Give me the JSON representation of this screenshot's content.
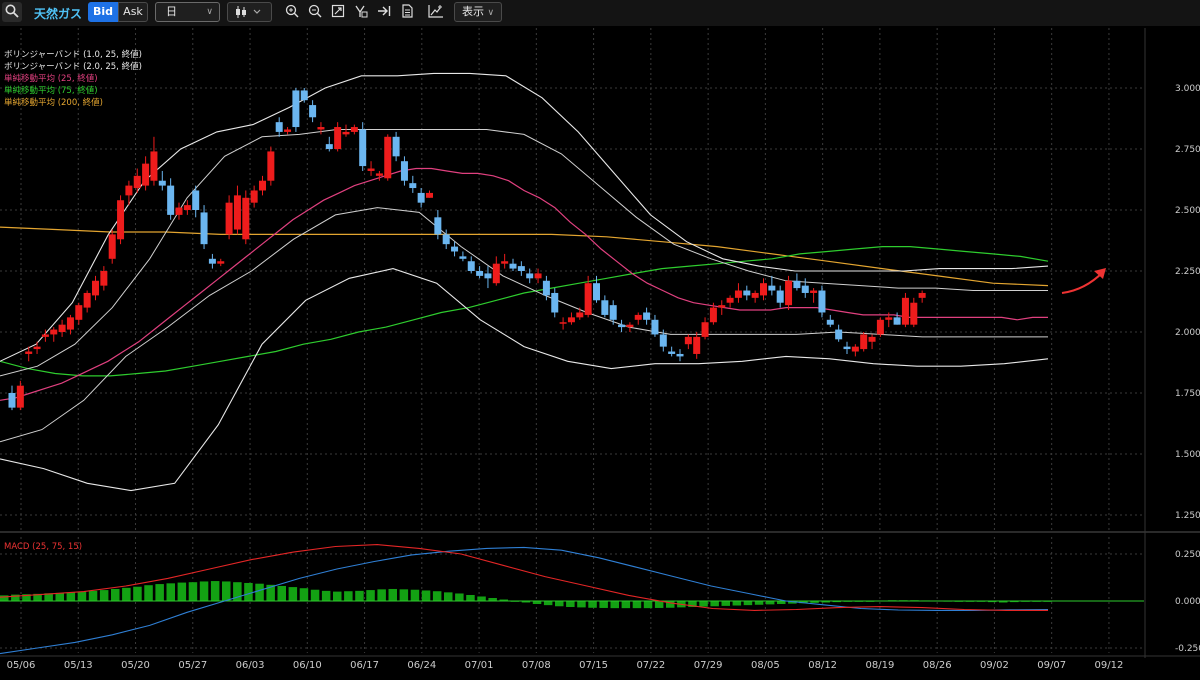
{
  "toolbar": {
    "search_icon": "search-icon",
    "instrument": "天然ガス",
    "bid_label": "Bid",
    "ask_label": "Ask",
    "timeframe": "日",
    "chart_type_icon": "candlestick-icon",
    "tools": [
      "zoom-in-icon",
      "zoom-out-icon",
      "fit-icon",
      "crosshair-icon",
      "go-latest-icon",
      "document-icon",
      "add-indicator-icon"
    ],
    "display_label": "表示",
    "accent": "#1e72e6",
    "instrument_color": "#4fc3f7"
  },
  "chart_data": [
    {
      "type": "candlestick",
      "title": "",
      "legend": [
        {
          "label": "ボリンジャーバンド (1.0, 25, 終値)",
          "color": "#e8e8e8"
        },
        {
          "label": "ボリンジャーバンド (2.0, 25, 終値)",
          "color": "#e8e8e8"
        },
        {
          "label": "単純移動平均 (25, 終値)",
          "color": "#e0407f"
        },
        {
          "label": "単純移動平均 (75, 終値)",
          "color": "#2ecc2e"
        },
        {
          "label": "単純移動平均 (200, 終値)",
          "color": "#e3a530"
        }
      ],
      "ylim": [
        1.175,
        3.05
      ],
      "yticks": [
        "3.000",
        "2.750",
        "2.500",
        "2.250",
        "2.000",
        "1.750",
        "1.500",
        "1.250"
      ],
      "xticks": [
        "05/06",
        "05/13",
        "05/20",
        "05/27",
        "06/03",
        "06/10",
        "06/17",
        "06/24",
        "07/01",
        "07/08",
        "07/15",
        "07/22",
        "07/29",
        "08/05",
        "08/12",
        "08/19",
        "08/26",
        "09/02",
        "09/07",
        "09/12"
      ],
      "up_color": "#ee1c1c",
      "down_color": "#6bb6f0",
      "candles": [
        [
          1.75,
          1.78,
          1.68,
          1.69
        ],
        [
          1.69,
          1.8,
          1.68,
          1.78
        ],
        [
          1.91,
          1.94,
          1.88,
          1.92
        ],
        [
          1.93,
          1.96,
          1.91,
          1.94
        ],
        [
          1.98,
          2.01,
          1.96,
          1.99
        ],
        [
          1.99,
          2.02,
          1.96,
          2.01
        ],
        [
          2.0,
          2.05,
          1.98,
          2.03
        ],
        [
          2.01,
          2.07,
          1.99,
          2.06
        ],
        [
          2.05,
          2.12,
          2.03,
          2.11
        ],
        [
          2.1,
          2.17,
          2.08,
          2.16
        ],
        [
          2.15,
          2.23,
          2.13,
          2.21
        ],
        [
          2.19,
          2.27,
          2.17,
          2.25
        ],
        [
          2.3,
          2.42,
          2.28,
          2.4
        ],
        [
          2.38,
          2.56,
          2.36,
          2.54
        ],
        [
          2.56,
          2.62,
          2.52,
          2.6
        ],
        [
          2.59,
          2.67,
          2.57,
          2.64
        ],
        [
          2.6,
          2.72,
          2.58,
          2.69
        ],
        [
          2.62,
          2.8,
          2.6,
          2.74
        ],
        [
          2.62,
          2.66,
          2.58,
          2.6
        ],
        [
          2.6,
          2.63,
          2.46,
          2.48
        ],
        [
          2.48,
          2.53,
          2.46,
          2.51
        ],
        [
          2.5,
          2.54,
          2.48,
          2.52
        ],
        [
          2.58,
          2.6,
          2.47,
          2.5
        ],
        [
          2.49,
          2.52,
          2.34,
          2.36
        ],
        [
          2.3,
          2.32,
          2.26,
          2.28
        ],
        [
          2.28,
          2.3,
          2.27,
          2.29
        ],
        [
          2.4,
          2.56,
          2.38,
          2.53
        ],
        [
          2.42,
          2.6,
          2.4,
          2.56
        ],
        [
          2.38,
          2.58,
          2.36,
          2.55
        ],
        [
          2.53,
          2.6,
          2.51,
          2.58
        ],
        [
          2.58,
          2.64,
          2.56,
          2.62
        ],
        [
          2.62,
          2.76,
          2.6,
          2.74
        ],
        [
          2.86,
          2.88,
          2.8,
          2.82
        ],
        [
          2.82,
          2.84,
          2.81,
          2.83
        ],
        [
          2.99,
          3.0,
          2.82,
          2.84
        ],
        [
          2.99,
          3.0,
          2.94,
          2.95
        ],
        [
          2.93,
          2.95,
          2.86,
          2.88
        ],
        [
          2.83,
          2.86,
          2.81,
          2.84
        ],
        [
          2.77,
          2.8,
          2.74,
          2.75
        ],
        [
          2.75,
          2.86,
          2.74,
          2.84
        ],
        [
          2.81,
          2.85,
          2.8,
          2.82
        ],
        [
          2.82,
          2.85,
          2.81,
          2.84
        ],
        [
          2.83,
          2.86,
          2.66,
          2.68
        ],
        [
          2.66,
          2.7,
          2.64,
          2.67
        ],
        [
          2.64,
          2.66,
          2.62,
          2.65
        ],
        [
          2.63,
          2.81,
          2.62,
          2.8
        ],
        [
          2.8,
          2.82,
          2.7,
          2.72
        ],
        [
          2.7,
          2.72,
          2.6,
          2.62
        ],
        [
          2.61,
          2.64,
          2.57,
          2.59
        ],
        [
          2.57,
          2.59,
          2.51,
          2.53
        ],
        [
          2.55,
          2.58,
          2.55,
          2.57
        ],
        [
          2.47,
          2.5,
          2.38,
          2.4
        ],
        [
          2.4,
          2.42,
          2.34,
          2.36
        ],
        [
          2.35,
          2.37,
          2.31,
          2.33
        ],
        [
          2.31,
          2.33,
          2.29,
          2.3
        ],
        [
          2.29,
          2.31,
          2.24,
          2.25
        ],
        [
          2.25,
          2.27,
          2.22,
          2.23
        ],
        [
          2.24,
          2.27,
          2.18,
          2.22
        ],
        [
          2.2,
          2.31,
          2.19,
          2.28
        ],
        [
          2.28,
          2.32,
          2.26,
          2.29
        ],
        [
          2.28,
          2.3,
          2.25,
          2.26
        ],
        [
          2.27,
          2.29,
          2.23,
          2.25
        ],
        [
          2.24,
          2.26,
          2.2,
          2.22
        ],
        [
          2.22,
          2.26,
          2.2,
          2.24
        ],
        [
          2.21,
          2.23,
          2.13,
          2.15
        ],
        [
          2.16,
          2.18,
          2.06,
          2.08
        ],
        [
          2.04,
          2.06,
          2.01,
          2.04
        ],
        [
          2.04,
          2.08,
          2.03,
          2.06
        ],
        [
          2.06,
          2.1,
          2.05,
          2.08
        ],
        [
          2.07,
          2.23,
          2.06,
          2.2
        ],
        [
          2.2,
          2.23,
          2.12,
          2.13
        ],
        [
          2.13,
          2.15,
          2.06,
          2.07
        ],
        [
          2.11,
          2.13,
          2.03,
          2.05
        ],
        [
          2.03,
          2.05,
          2.0,
          2.02
        ],
        [
          2.02,
          2.04,
          2.0,
          2.03
        ],
        [
          2.05,
          2.08,
          2.03,
          2.07
        ],
        [
          2.08,
          2.1,
          2.03,
          2.05
        ],
        [
          2.05,
          2.07,
          1.98,
          1.99
        ],
        [
          1.99,
          2.01,
          1.92,
          1.94
        ],
        [
          1.92,
          1.94,
          1.9,
          1.91
        ],
        [
          1.91,
          1.93,
          1.88,
          1.9
        ],
        [
          1.95,
          1.99,
          1.93,
          1.98
        ],
        [
          1.91,
          2.0,
          1.89,
          1.98
        ],
        [
          1.98,
          2.06,
          1.97,
          2.04
        ],
        [
          2.04,
          2.12,
          2.03,
          2.1
        ],
        [
          2.1,
          2.13,
          2.07,
          2.11
        ],
        [
          2.12,
          2.15,
          2.1,
          2.14
        ],
        [
          2.14,
          2.2,
          2.12,
          2.17
        ],
        [
          2.17,
          2.19,
          2.13,
          2.15
        ],
        [
          2.14,
          2.17,
          2.12,
          2.16
        ],
        [
          2.15,
          2.22,
          2.13,
          2.2
        ],
        [
          2.19,
          2.23,
          2.15,
          2.17
        ],
        [
          2.17,
          2.19,
          2.1,
          2.12
        ],
        [
          2.11,
          2.23,
          2.09,
          2.21
        ],
        [
          2.21,
          2.24,
          2.17,
          2.18
        ],
        [
          2.19,
          2.22,
          2.14,
          2.16
        ],
        [
          2.16,
          2.18,
          2.12,
          2.17
        ],
        [
          2.17,
          2.19,
          2.06,
          2.08
        ],
        [
          2.05,
          2.07,
          2.02,
          2.03
        ],
        [
          2.01,
          2.03,
          1.96,
          1.97
        ],
        [
          1.94,
          1.96,
          1.91,
          1.93
        ],
        [
          1.92,
          1.95,
          1.9,
          1.94
        ],
        [
          1.93,
          2.0,
          1.92,
          1.99
        ],
        [
          1.96,
          1.99,
          1.93,
          1.98
        ],
        [
          1.99,
          2.06,
          1.98,
          2.05
        ],
        [
          2.05,
          2.08,
          2.02,
          2.06
        ],
        [
          2.06,
          2.08,
          2.03,
          2.03
        ],
        [
          2.03,
          2.16,
          2.02,
          2.14
        ],
        [
          2.03,
          2.14,
          2.02,
          2.12
        ],
        [
          2.14,
          2.17,
          2.12,
          2.16
        ]
      ],
      "ma25": [
        1.72,
        1.73,
        1.75,
        1.77,
        1.79,
        1.82,
        1.85,
        1.88,
        1.92,
        1.96,
        2.01,
        2.06,
        2.11,
        2.16,
        2.21,
        2.26,
        2.31,
        2.36,
        2.41,
        2.46,
        2.5,
        2.54,
        2.57,
        2.6,
        2.62,
        2.64,
        2.66,
        2.67,
        2.67,
        2.66,
        2.65,
        2.65,
        2.64,
        2.62,
        2.58,
        2.55,
        2.51,
        2.45,
        2.4,
        2.34,
        2.29,
        2.24,
        2.2,
        2.17,
        2.14,
        2.12,
        2.11,
        2.1,
        2.09,
        2.09,
        2.09,
        2.1,
        2.1,
        2.1,
        2.09,
        2.08,
        2.07,
        2.07,
        2.07,
        2.06,
        2.06,
        2.06,
        2.06,
        2.06,
        2.06,
        2.06,
        2.05,
        2.06,
        2.06
      ],
      "ma75": [
        1.88,
        1.85,
        1.83,
        1.82,
        1.82,
        1.83,
        1.84,
        1.86,
        1.88,
        1.9,
        1.92,
        1.95,
        1.97,
        2.0,
        2.02,
        2.05,
        2.08,
        2.1,
        2.13,
        2.16,
        2.18,
        2.2,
        2.22,
        2.24,
        2.26,
        2.27,
        2.28,
        2.29,
        2.3,
        2.32,
        2.33,
        2.34,
        2.35,
        2.35,
        2.34,
        2.33,
        2.32,
        2.31,
        2.29
      ],
      "ma200": [
        2.43,
        2.42,
        2.41,
        2.41,
        2.4,
        2.4,
        2.4,
        2.4,
        2.4,
        2.4,
        2.4,
        2.39,
        2.37,
        2.35,
        2.32,
        2.29,
        2.26,
        2.23,
        2.2,
        2.19
      ],
      "bb1_upper": [
        1.82,
        1.86,
        1.95,
        2.1,
        2.3,
        2.55,
        2.72,
        2.8,
        2.81,
        2.83,
        2.83,
        2.83,
        2.83,
        2.83,
        2.81,
        2.73,
        2.6,
        2.47,
        2.36,
        2.3,
        2.25,
        2.21,
        2.2,
        2.19,
        2.18,
        2.18,
        2.17,
        2.17,
        2.17
      ],
      "bb1_lower": [
        1.55,
        1.6,
        1.72,
        1.9,
        2.02,
        2.15,
        2.25,
        2.38,
        2.48,
        2.51,
        2.49,
        2.35,
        2.23,
        2.15,
        2.08,
        2.02,
        1.99,
        1.99,
        1.99,
        1.99,
        2.0,
        1.99,
        1.98,
        1.98,
        1.98,
        1.98
      ],
      "bb2_upper": [
        1.88,
        1.95,
        2.12,
        2.4,
        2.62,
        2.75,
        2.82,
        2.85,
        2.92,
        3.0,
        3.05,
        3.05,
        3.06,
        3.06,
        3.05,
        2.96,
        2.82,
        2.65,
        2.48,
        2.37,
        2.3,
        2.27,
        2.25,
        2.25,
        2.25,
        2.25,
        2.26,
        2.26,
        2.26,
        2.27
      ],
      "bb2_lower": [
        1.48,
        1.44,
        1.38,
        1.35,
        1.38,
        1.62,
        1.95,
        2.13,
        2.22,
        2.26,
        2.2,
        2.05,
        1.94,
        1.88,
        1.85,
        1.87,
        1.87,
        1.88,
        1.9,
        1.89,
        1.87,
        1.86,
        1.86,
        1.87,
        1.89
      ]
    },
    {
      "type": "bar",
      "title": "MACD (25, 75, 15)",
      "ylim": [
        -0.28,
        0.32
      ],
      "yticks": [
        "0.250",
        "0.000",
        "-0.250"
      ],
      "hist_color": "#13a113",
      "macd_color": "#e32626",
      "signal_color": "#2f7fd4",
      "hist": [
        0.03,
        0.034,
        0.036,
        0.038,
        0.041,
        0.043,
        0.046,
        0.05,
        0.054,
        0.058,
        0.064,
        0.07,
        0.076,
        0.084,
        0.09,
        0.094,
        0.098,
        0.1,
        0.104,
        0.106,
        0.104,
        0.1,
        0.096,
        0.092,
        0.086,
        0.08,
        0.074,
        0.068,
        0.06,
        0.054,
        0.05,
        0.052,
        0.054,
        0.058,
        0.062,
        0.064,
        0.062,
        0.06,
        0.056,
        0.052,
        0.046,
        0.04,
        0.032,
        0.024,
        0.016,
        0.008,
        0,
        -0.008,
        -0.016,
        -0.022,
        -0.028,
        -0.032,
        -0.034,
        -0.036,
        -0.037,
        -0.038,
        -0.038,
        -0.038,
        -0.038,
        -0.037,
        -0.036,
        -0.034,
        -0.032,
        -0.03,
        -0.028,
        -0.026,
        -0.024,
        -0.022,
        -0.02,
        -0.018,
        -0.016,
        -0.014,
        -0.012,
        -0.01,
        -0.008,
        -0.006,
        -0.004,
        -0.002,
        0,
        0.002,
        0.004,
        0.004,
        0.004,
        0.003,
        0.002,
        0.001,
        0,
        -0.002,
        -0.004,
        -0.006,
        -0.008,
        -0.006,
        -0.004,
        -0.002,
        0
      ],
      "macd": [
        0.02,
        0.035,
        0.05,
        0.08,
        0.12,
        0.17,
        0.22,
        0.26,
        0.29,
        0.3,
        0.28,
        0.25,
        0.19,
        0.13,
        0.08,
        0.03,
        -0.01,
        -0.04,
        -0.05,
        -0.045,
        -0.035,
        -0.03,
        -0.035,
        -0.045,
        -0.05,
        -0.05
      ],
      "signal": [
        -0.28,
        -0.25,
        -0.22,
        -0.18,
        -0.13,
        -0.06,
        0.0,
        0.06,
        0.12,
        0.17,
        0.21,
        0.245,
        0.265,
        0.28,
        0.285,
        0.27,
        0.23,
        0.18,
        0.13,
        0.08,
        0.04,
        0.0,
        -0.02,
        -0.04,
        -0.048,
        -0.05,
        -0.05,
        -0.047,
        -0.045
      ]
    }
  ]
}
